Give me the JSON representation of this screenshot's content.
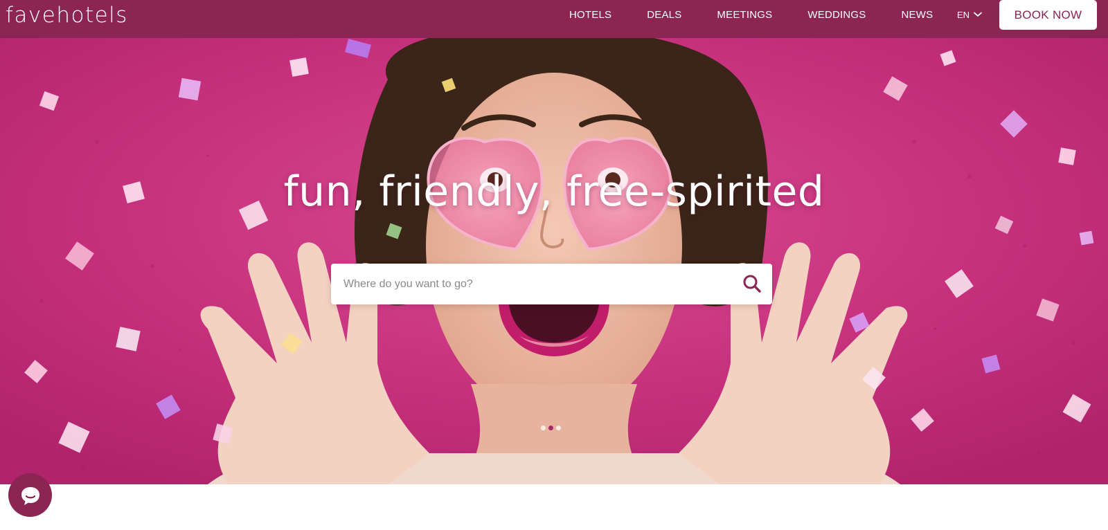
{
  "brand": {
    "logo_text": "favehotels",
    "primary_color": "#8c2454",
    "hero_color": "#c8307e"
  },
  "nav": {
    "items": [
      {
        "label": "HOTELS"
      },
      {
        "label": "DEALS"
      },
      {
        "label": "MEETINGS"
      },
      {
        "label": "WEDDINGS"
      },
      {
        "label": "NEWS"
      }
    ],
    "language": "EN",
    "language_icon": "chevron-down-icon",
    "book_label": "BOOK NOW"
  },
  "hero": {
    "title": "fun, friendly, free-spirited",
    "search_placeholder": "Where do you want to go?",
    "search_icon": "search-icon",
    "carousel": {
      "slide_count": 3,
      "active_slide": 2
    }
  },
  "chat": {
    "icon": "chat-bubble-icon"
  }
}
